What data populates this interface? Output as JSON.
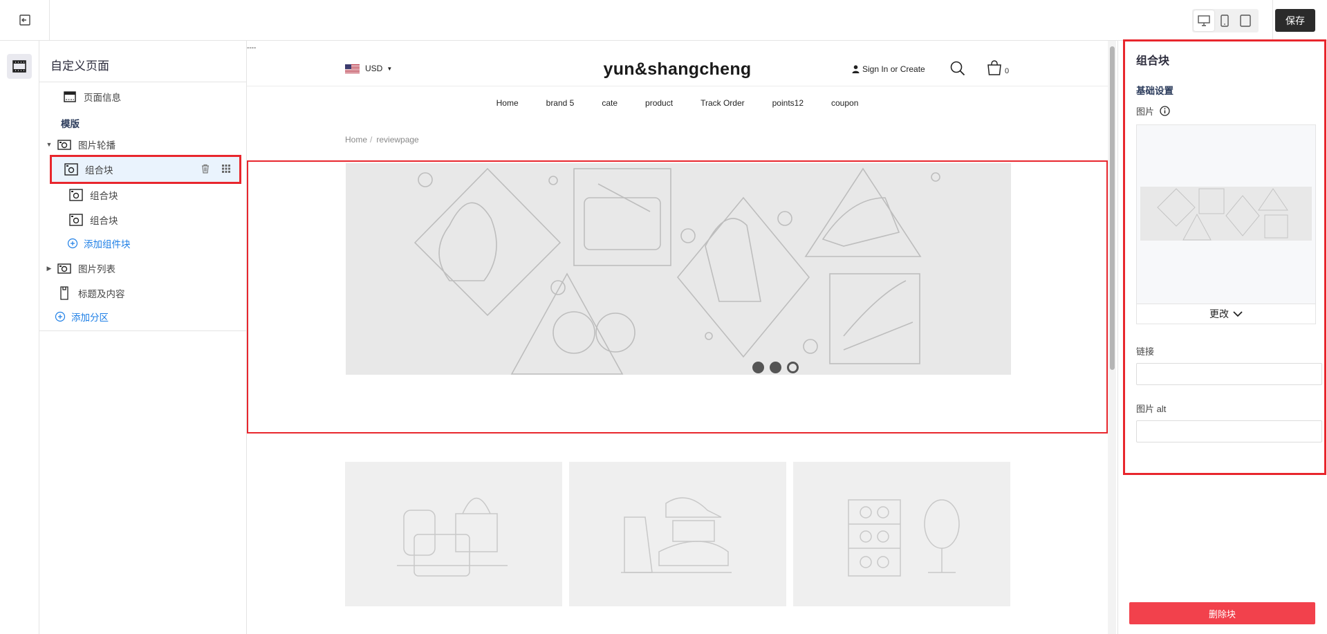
{
  "toolbar": {
    "save_label": "保存",
    "devices": [
      "desktop-icon",
      "mobile-icon",
      "tablet-icon"
    ],
    "active_device": "desktop"
  },
  "tree": {
    "title": "自定义页面",
    "page_info": "页面信息",
    "section_label": "模版",
    "carousel": {
      "label": "图片轮播",
      "blocks": [
        "组合块",
        "组合块",
        "组合块"
      ],
      "add_block": "添加组件块"
    },
    "image_list": "图片列表",
    "title_content": "标题及内容",
    "add_section": "添加分区"
  },
  "preview": {
    "top_mark": "----",
    "currency": "USD",
    "store_name": "yun&shangcheng",
    "signin": "Sign In or Create",
    "cart_count": "0",
    "nav": [
      "Home",
      "brand 5",
      "cate",
      "product",
      "Track Order",
      "points12",
      "coupon"
    ],
    "breadcrumb": {
      "home": "Home",
      "sep": "/",
      "current": "reviewpage"
    },
    "carousel_dots": 3,
    "carousel_active_dot": 3
  },
  "right_panel": {
    "title": "组合块",
    "section": "基础设置",
    "image_label": "图片",
    "change_label": "更改",
    "link_label": "链接",
    "link_value": "",
    "alt_label": "图片 alt",
    "alt_value": "",
    "delete_label": "删除块"
  },
  "colors": {
    "highlight": "#e8262d",
    "link": "#1e7fe6",
    "danger": "#f2414c",
    "save": "#2b2b2b"
  }
}
